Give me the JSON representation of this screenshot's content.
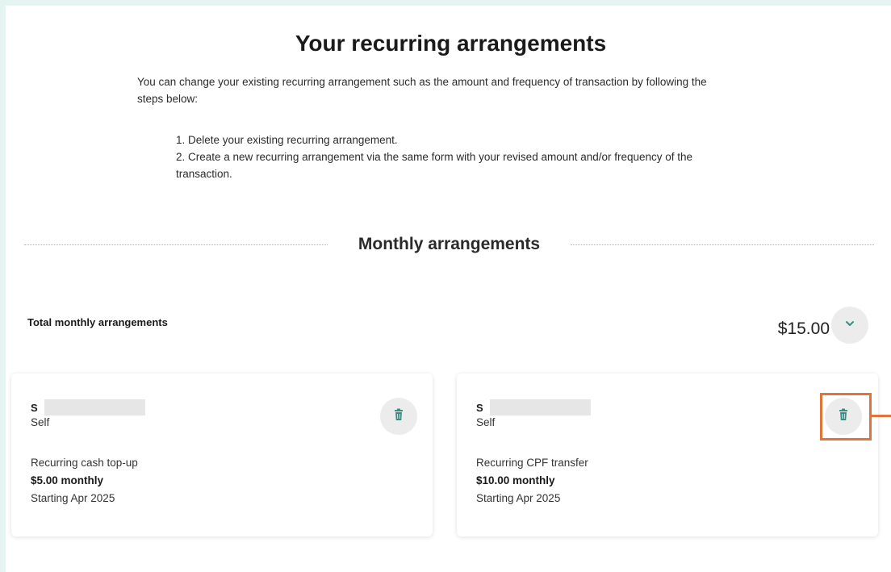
{
  "page": {
    "title": "Your recurring arrangements",
    "intro": "You can change your existing recurring arrangement such as the amount and frequency of transaction by following the steps below:",
    "steps": [
      "1.   Delete your existing recurring arrangement.",
      "2.   Create a new recurring arrangement via the same form with your revised amount and/or frequency of the transaction."
    ]
  },
  "section": {
    "title": "Monthly arrangements",
    "total_label": "Total monthly arrangements",
    "total_amount": "$15.00",
    "expand_icon": "chevron-down-icon"
  },
  "arrangements": [
    {
      "name_initial": "S",
      "relation": "Self",
      "type": "Recurring cash top-up",
      "amount": "$5.00 monthly",
      "start": "Starting Apr 2025",
      "delete_icon": "trash-icon"
    },
    {
      "name_initial": "S",
      "relation": "Self",
      "type": "Recurring CPF transfer",
      "amount": "$10.00 monthly",
      "start": "Starting Apr 2025",
      "delete_icon": "trash-icon",
      "highlighted": true
    }
  ],
  "colors": {
    "background": "#e4f4f1",
    "accent_teal": "#3d8c84",
    "highlight_orange": "#e0743a",
    "button_grey": "#ececec"
  }
}
